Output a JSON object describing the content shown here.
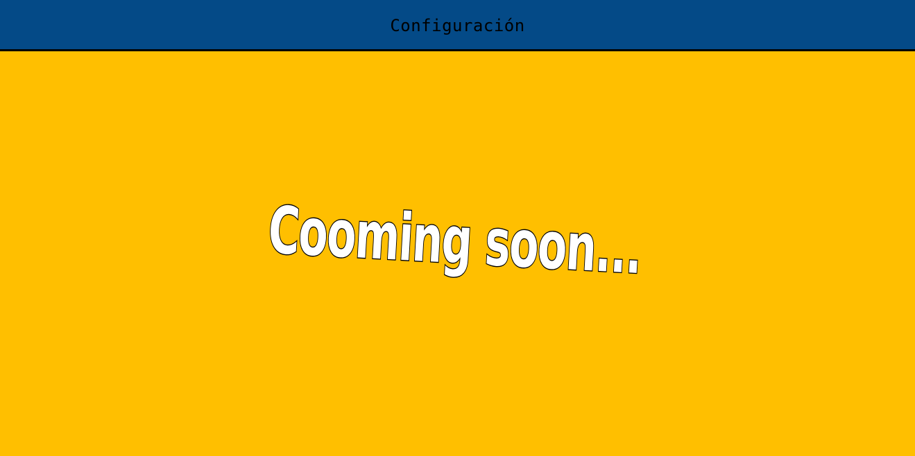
{
  "header": {
    "title": "Configuración"
  },
  "main": {
    "banner_text": "Cooming soon..."
  },
  "colors": {
    "header_background": "#044a87",
    "header_border": "#000000",
    "page_background": "#ffbf00",
    "banner_fill": "#ffffff",
    "banner_outline": "#000000"
  }
}
